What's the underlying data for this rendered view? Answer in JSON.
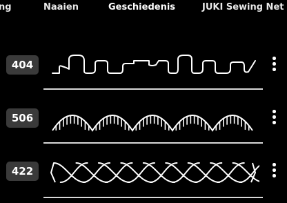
{
  "tabs": {
    "prev_partial": "ng",
    "sew": "Naaien",
    "history": "Geschiedenis",
    "net": "JUKI Sewing Net"
  },
  "history": {
    "items": [
      {
        "number": "404",
        "stitch_icon": "square-wave-stitch-icon"
      },
      {
        "number": "506",
        "stitch_icon": "scallop-satin-stitch-icon"
      },
      {
        "number": "422",
        "stitch_icon": "rope-twist-stitch-icon"
      }
    ],
    "menu_icon": "more-vertical-icon"
  },
  "colors": {
    "background": "#000000",
    "badge": "#3a3a3a",
    "text": "#ffffff",
    "divider": "#d9d9d9"
  }
}
